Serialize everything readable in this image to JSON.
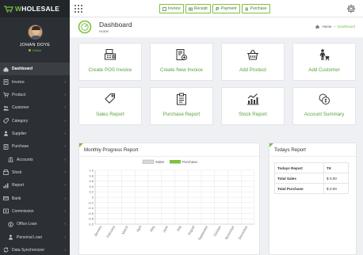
{
  "brand": {
    "logo_prefix": "W",
    "logo_main": "HOLESALE"
  },
  "user": {
    "name": "JOHAN DOYE",
    "status": "Online"
  },
  "sidebar": {
    "items": [
      {
        "label": "Dashboard",
        "icon": "home-icon",
        "caret": ""
      },
      {
        "label": "Invoice",
        "icon": "invoice-icon",
        "caret": "‹"
      },
      {
        "label": "Product",
        "icon": "cart-icon",
        "caret": "‹"
      },
      {
        "label": "Customer",
        "icon": "users-icon",
        "caret": "‹"
      },
      {
        "label": "Category",
        "icon": "tag-icon",
        "caret": "‹"
      },
      {
        "label": "Supplier",
        "icon": "user-icon",
        "caret": "‹"
      },
      {
        "label": "Purchase",
        "icon": "purchase-icon",
        "caret": "‹"
      },
      {
        "label": "Accounts",
        "icon": "accounts-icon",
        "caret": "‹"
      },
      {
        "label": "Stock",
        "icon": "stock-icon",
        "caret": "‹"
      },
      {
        "label": "Report",
        "icon": "report-icon",
        "caret": "‹"
      },
      {
        "label": "Bank",
        "icon": "bank-icon",
        "caret": "‹"
      },
      {
        "label": "Commission",
        "icon": "commission-icon",
        "caret": "‹"
      },
      {
        "label": "Office Loan",
        "icon": "office-loan-icon",
        "caret": "‹"
      },
      {
        "label": "Personal Loan",
        "icon": "personal-loan-icon",
        "caret": "‹"
      },
      {
        "label": "Data Synchronizer",
        "icon": "sync-icon",
        "caret": "‹"
      }
    ]
  },
  "topbar": {
    "quick_buttons": [
      {
        "label": "Invoice",
        "icon": "invoice-icon"
      },
      {
        "label": "Receipt",
        "icon": "money-icon"
      },
      {
        "label": "Payment",
        "icon": "payment-icon"
      },
      {
        "label": "Purchase",
        "icon": "purchase-icon"
      }
    ]
  },
  "page": {
    "title": "Dashboard",
    "subtitle": "Home",
    "breadcrumb": [
      "Home",
      "Dashboard"
    ]
  },
  "cards": [
    {
      "label": "Create POS Invoice",
      "icon": "pos-icon"
    },
    {
      "label": "Create New Invoice",
      "icon": "new-invoice-icon"
    },
    {
      "label": "Add Product",
      "icon": "basket-icon"
    },
    {
      "label": "Add Customer",
      "icon": "add-customer-icon"
    },
    {
      "label": "Sales Report",
      "icon": "tag-icon"
    },
    {
      "label": "Purchase Report",
      "icon": "clipboard-icon"
    },
    {
      "label": "Stock Report",
      "icon": "stock-chart-icon"
    },
    {
      "label": "Account Summary",
      "icon": "account-summary-icon"
    }
  ],
  "progress": {
    "title": "Monthly Progress Report"
  },
  "todays": {
    "title": "Todays Report",
    "header": [
      "Todays Report",
      "TK"
    ],
    "rows": [
      [
        "Total Sales",
        "$ 0.00"
      ],
      [
        "Total Purchase",
        "$ 0.00"
      ]
    ]
  },
  "colors": {
    "accent": "#7cc142",
    "sidebar": "#2c3034",
    "legend_sales": "#d8d8d8",
    "legend_purchase": "#7cc142"
  },
  "chart_data": {
    "type": "bar",
    "title": "Monthly Progress Report",
    "categories": [
      "January",
      "February",
      "March",
      "April",
      "May",
      "June",
      "July",
      "August",
      "September",
      "October",
      "November",
      "December"
    ],
    "series": [
      {
        "name": "Sales",
        "values": [
          0,
          0,
          0,
          0,
          0,
          0,
          0,
          0,
          0,
          0,
          0,
          0
        ]
      },
      {
        "name": "Purchase",
        "values": [
          0,
          0,
          0,
          0,
          0,
          0,
          0,
          0,
          0,
          0,
          0,
          0
        ]
      }
    ],
    "ylim": [
      -1.0,
      1.0
    ],
    "yticks": [
      "1.0",
      "0.8",
      "0.6",
      "0.4",
      "0.2",
      "0",
      "-0.2",
      "-0.4",
      "-0.6",
      "-0.8",
      "-1.0"
    ],
    "xlabel": "",
    "ylabel": "",
    "grid": true,
    "legend": "top-center"
  }
}
